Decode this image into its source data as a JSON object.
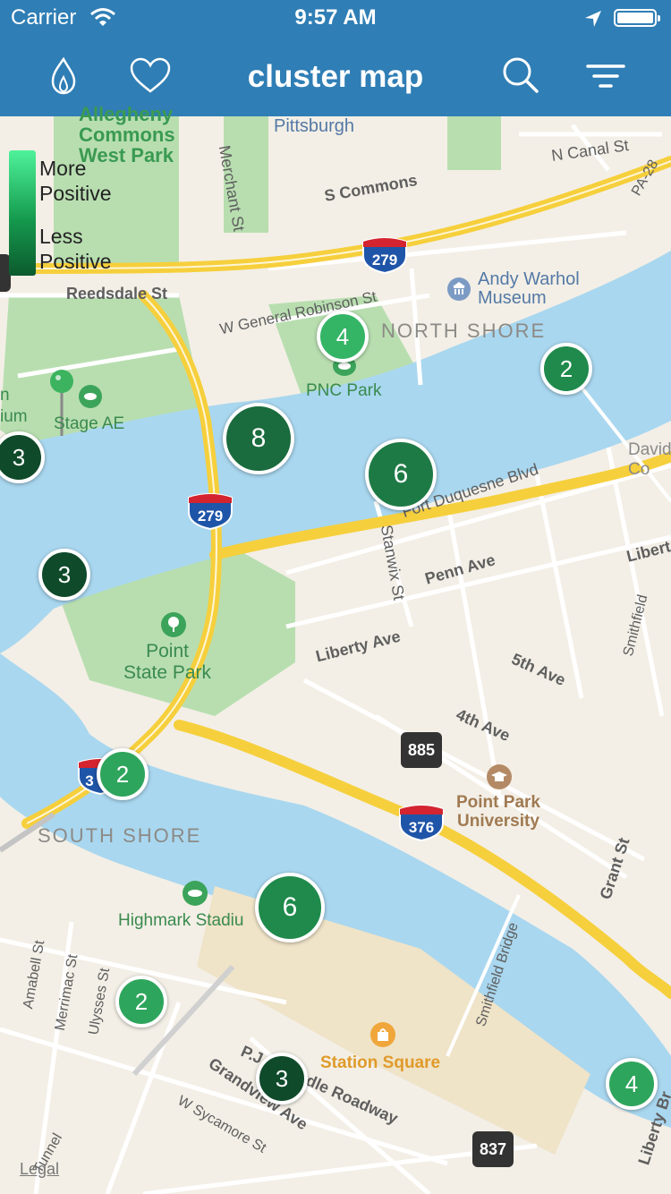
{
  "status_bar": {
    "carrier": "Carrier",
    "time": "9:57 AM"
  },
  "navbar": {
    "title": "cluster map",
    "buttons": [
      "flame-icon",
      "heart-icon",
      "search-icon",
      "filter-icon"
    ]
  },
  "legend": {
    "top": "More\nPositive",
    "bottom": "Less\nPositive",
    "colors": [
      "#4ef29a",
      "#0c5a2d"
    ]
  },
  "map": {
    "places": {
      "allegheny": "Allegheny\nCommons\nWest Park",
      "pittsburgh": "Pittsburgh",
      "andy_warhol": "Andy Warhol\nMuseum",
      "north_shore": "NORTH SHORE",
      "pnc_park": "PNC Park",
      "stage_ae": "Stage AE",
      "point_state_park": "Point\nState Park",
      "south_shore": "SOUTH SHORE",
      "highmark": "Highmark Stadiu",
      "point_park_university": "Point Park\nUniversity",
      "station_square": "Station Square",
      "david": "David\nCo",
      "stadium_fragment": "n\nium"
    },
    "streets": {
      "merchant": "Merchant St",
      "s_commons": "S Commons",
      "n_canal": "N Canal St",
      "pa28": "PA-28",
      "reedsdale": "Reedsdale St",
      "general_robinson": "W General Robinson St",
      "fort_duquesne": "Fort Duquesne Blvd",
      "stanwix": "Stanwix St",
      "penn": "Penn Ave",
      "liberty": "Liberty Ave",
      "liberty_right": "Libert",
      "fifth": "5th Ave",
      "fourth": "4th Ave",
      "smithfield": "Smithfield",
      "smithfield_bridge": "Smithfield Bridge",
      "grant": "Grant St",
      "amabell": "Amabell St",
      "merrimac": "Merrimac St",
      "ulysses": "Ulysses St",
      "pj_roadway": "P.J. McArdle Roadway",
      "grandview": "Grandview Ave",
      "sycamore": "W Sycamore St",
      "liberty_bridge": "Liberty Br",
      "tunnel": "Tunnel"
    },
    "highways": {
      "i279_top": "279",
      "i279_mid": "279",
      "i376": "376",
      "i3_left": "3",
      "r885": "885",
      "r837": "837"
    },
    "clusters": [
      {
        "count": "4",
        "color": "#34b566"
      },
      {
        "count": "2",
        "color": "#1f8a4b"
      },
      {
        "count": "8",
        "color": "#1a6b3d"
      },
      {
        "count": "6",
        "color": "#1e7a45"
      },
      {
        "count": "3",
        "color": "#0f4a2a"
      },
      {
        "count": "3",
        "color": "#0f4a2a"
      },
      {
        "count": "2",
        "color": "#2ea55c"
      },
      {
        "count": "6",
        "color": "#1f8a4b"
      },
      {
        "count": "2",
        "color": "#2ea55c"
      },
      {
        "count": "3",
        "color": "#0f4a2a"
      },
      {
        "count": "4",
        "color": "#2ea55c"
      }
    ],
    "legal": "Legal"
  }
}
